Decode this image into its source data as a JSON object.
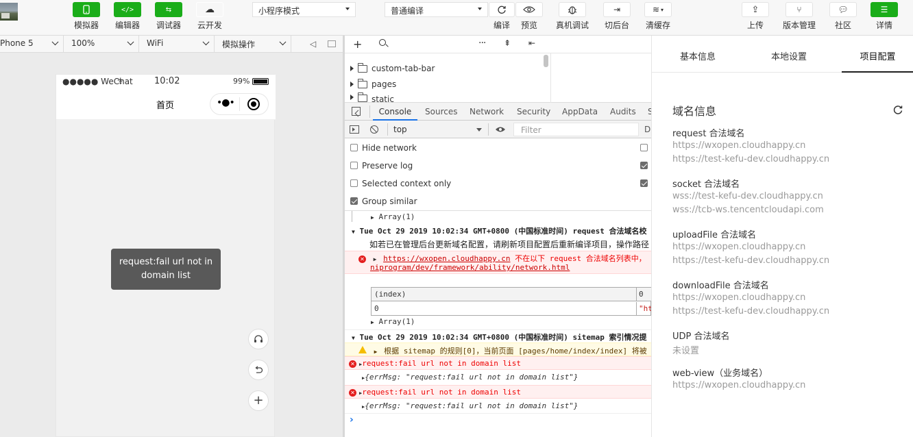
{
  "toolbar": {
    "simulator": "模拟器",
    "editor": "编辑器",
    "debugger": "调试器",
    "cloud": "云开发",
    "mode": "小程序模式",
    "compile_mode": "普通编译",
    "compile": "编译",
    "preview": "预览",
    "remote_debug": "真机调试",
    "background": "切后台",
    "clear_cache": "清缓存",
    "upload": "上传",
    "version": "版本管理",
    "community": "社区",
    "details": "详情"
  },
  "device_bar": {
    "device": "Phone 5",
    "zoom": "100%",
    "network": "WiFi",
    "operation": "模拟操作"
  },
  "phone": {
    "carrier": "●●●●● WeChat",
    "time": "10:02",
    "battery": "99%",
    "page_title": "首页",
    "toast": "request:fail url not in domain list"
  },
  "filetree": {
    "items": [
      "custom-tab-bar",
      "pages",
      "static"
    ]
  },
  "devtools": {
    "tabs": [
      "Console",
      "Sources",
      "Network",
      "Security",
      "AppData",
      "Audits"
    ],
    "context": "top",
    "filter_placeholder": "Filter",
    "defaults_label": "D",
    "options": [
      "Hide network",
      "Preserve log",
      "Selected context only",
      "Group similar"
    ],
    "logs": {
      "array1": "Array(1)",
      "group1_header": "Tue Oct 29 2019 10:02:34 GMT+0800 (中国标准时间) request 合法域名校",
      "group1_msg": "如若已在管理后台更新域名配置，请刷新项目配置后重新编译项目，操作路径",
      "err1_link": "https://wxopen.cloudhappy.cn",
      "err1_text": " 不在以下 request 合法域名列表中，",
      "err1_doc": "niprogram/dev/framework/ability/network.html",
      "table_header_index": "(index)",
      "table_header_0": "0",
      "table_row_index": "0",
      "table_row_value": "\"ht",
      "array2": "Array(1)",
      "group2_header": "Tue Oct 29 2019 10:02:34 GMT+0800 (中国标准时间) sitemap 索引情况提",
      "warn_text": "根据 sitemap 的规则[0]，当前页面 [pages/home/index/index] 将被",
      "err2": "request:fail url not in domain list",
      "obj2": "{errMsg: \"request:fail url not in domain list\"}",
      "err3": "request:fail url not in domain list",
      "obj3": "{errMsg: \"request:fail url not in domain list\"}",
      "prompt": "›"
    }
  },
  "right_panel": {
    "tabs": [
      "基本信息",
      "本地设置",
      "项目配置"
    ],
    "domain_info_title": "域名信息",
    "sections": [
      {
        "title": "request 合法域名",
        "values": [
          "https://wxopen.cloudhappy.cn",
          "https://test-kefu-dev.cloudhappy.cn"
        ]
      },
      {
        "title": "socket 合法域名",
        "values": [
          "wss://test-kefu-dev.cloudhappy.cn",
          "wss://tcb-ws.tencentcloudapi.com"
        ]
      },
      {
        "title": "uploadFile 合法域名",
        "values": [
          "https://wxopen.cloudhappy.cn",
          "https://test-kefu-dev.cloudhappy.cn"
        ]
      },
      {
        "title": "downloadFile 合法域名",
        "values": [
          "https://wxopen.cloudhappy.cn",
          "https://test-kefu-dev.cloudhappy.cn"
        ]
      },
      {
        "title": "UDP 合法域名",
        "values": [
          "未设置"
        ]
      },
      {
        "title": "web-view（业务域名）",
        "values": [
          "https://wxopen.cloudhappy.cn"
        ]
      }
    ]
  },
  "colors": {
    "accent_green": "#1aad19",
    "error_red": "#e41e1e",
    "warning_yellow": "#f5bd00",
    "active_tab_blue": "#1a73e8"
  }
}
